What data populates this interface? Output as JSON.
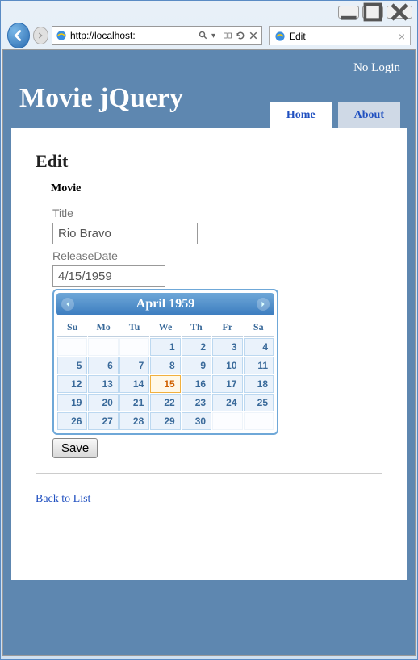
{
  "browser": {
    "url_display": "http://localhost:",
    "tab_title": "Edit",
    "search_icon": "magnifier"
  },
  "header": {
    "login_text": "No Login",
    "app_title": "Movie jQuery",
    "nav": {
      "home": "Home",
      "about": "About"
    }
  },
  "page": {
    "heading": "Edit",
    "legend": "Movie",
    "title_label": "Title",
    "title_value": "Rio Bravo",
    "date_label": "ReleaseDate",
    "date_value": "4/15/1959",
    "save_label": "Save",
    "back_link": "Back to List"
  },
  "datepicker": {
    "month_label": "April 1959",
    "day_headers": [
      "Su",
      "Mo",
      "Tu",
      "We",
      "Th",
      "Fr",
      "Sa"
    ],
    "weeks": [
      [
        "",
        "",
        "",
        "1",
        "2",
        "3",
        "4"
      ],
      [
        "5",
        "6",
        "7",
        "8",
        "9",
        "10",
        "11"
      ],
      [
        "12",
        "13",
        "14",
        "15",
        "16",
        "17",
        "18"
      ],
      [
        "19",
        "20",
        "21",
        "22",
        "23",
        "24",
        "25"
      ],
      [
        "26",
        "27",
        "28",
        "29",
        "30",
        "",
        ""
      ]
    ],
    "selected": "15"
  },
  "colors": {
    "app_bg": "#5e87b0",
    "accent": "#2050c0",
    "dp_header": "#3b7cbf",
    "dp_cell": "#eaf2fb",
    "dp_selected": "#f0b040"
  }
}
